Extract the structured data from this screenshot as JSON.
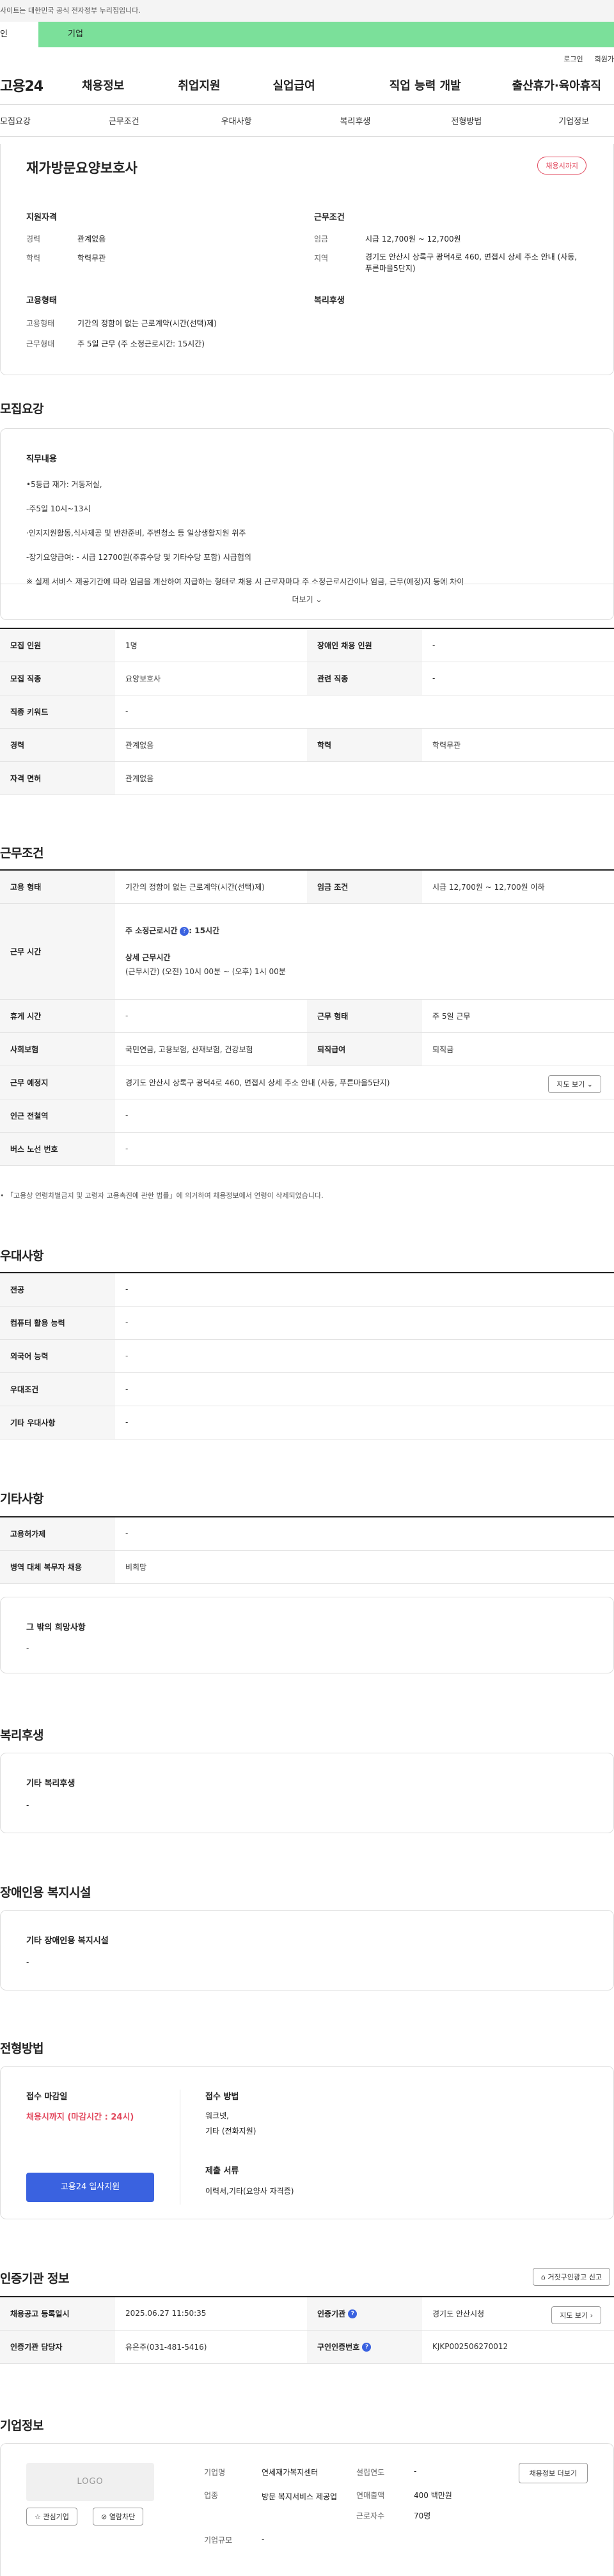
{
  "notice": "사이트는 대한민국 공식 전자정부 누리집입니다.",
  "user_tabs": [
    "인",
    "기업"
  ],
  "top_links": [
    "로그인",
    "회원가"
  ],
  "logo": "고용24",
  "gnb": [
    "채용정보",
    "취업지원",
    "실업급여",
    "직업 능력 개발",
    "출산휴가·육아휴직"
  ],
  "sub_tabs": [
    "모집요강",
    "근무조건",
    "우대사항",
    "복리후생",
    "전형방법",
    "기업정보"
  ],
  "job": {
    "title": "재가방문요양보호사",
    "badge": "채용시까지",
    "qual_h": "지원자격",
    "qual": [
      [
        "경력",
        "관계없음"
      ],
      [
        "학력",
        "학력무관"
      ]
    ],
    "cond_h": "근무조건",
    "cond": [
      [
        "임금",
        "시급 12,700원 ~ 12,700원"
      ],
      [
        "지역",
        "경기도 안산시 상록구 광덕4로 460, 면접시 상세 주소 안내 (사동, 푸른마을5단지)"
      ]
    ],
    "emp_h": "고용형태",
    "emp": [
      [
        "고용형태",
        "기간의 정함이 없는 근로계약(시간(선택)제)"
      ],
      [
        "근무형태",
        "주 5일 근무 (주 소정근로시간: 15시간)"
      ]
    ],
    "welfare_h": "복리후생"
  },
  "recruit": {
    "h": "모집요강",
    "duty_h": "직무내용",
    "lines": [
      "•5등급 재가: 거동저실,",
      "-주5일 10시~13시",
      "·인지지원활동,식사제공 및 반찬준비, 주변청소 등 일상생활지원 위주",
      "-장기요양급여: - 시급 12700원(주휴수당 및 기타수당 포함) 시급협의",
      "※ 실제 서비스 제공기간에 따라 임금을 계산하여 지급하는 형태로 채용 시 근로자마다 주 소정근로시간이나 임금, 근무(예정)지 등에 차이"
    ],
    "more": "더보기",
    "rows": [
      [
        "모집 인원",
        "1명",
        "장애인 채용 인원",
        "-"
      ],
      [
        "모집 직종",
        "요양보호사",
        "관련 직종",
        "-"
      ],
      [
        "직종 키워드",
        "-"
      ],
      [
        "경력",
        "관계없음",
        "학력",
        "학력무관"
      ],
      [
        "자격 면허",
        "관계없음"
      ]
    ]
  },
  "workcond": {
    "h": "근무조건",
    "type_l": "고용 형태",
    "type_v": "기간의 정함이 없는 근로계약(시간(선택)제)",
    "wage_l": "임금 조건",
    "wage_v": "시급 12,700원 ~ 12,700원 이하",
    "time_l": "근무 시간",
    "hours_l": "주 소정근로시간",
    "hours_v": ": 15시간",
    "detail_l": "상세 근무시간",
    "detail_v": "(근무시간) (오전) 10시 00분 ~ (오후) 1시 00분",
    "rest_l": "휴게 시간",
    "rest_v": "-",
    "form_l": "근무 형태",
    "form_v": "주 5일 근무",
    "ins_l": "사회보험",
    "ins_v": "국민연금, 고용보험, 산재보험, 건강보험",
    "ret_l": "퇴직급여",
    "ret_v": "퇴직금",
    "loc_l": "근무 예정지",
    "loc_v": "경기도 안산시 상록구 광덕4로 460, 면접시 상세 주소 안내 (사동, 푸른마을5단지)",
    "map": "지도 보기",
    "sub_l": "인근 전철역",
    "sub_v": "-",
    "bus_l": "버스 노선 번호",
    "bus_v": "-",
    "note": "• 「고용상 연령차별금지 및 고령자 고용촉진에 관한 법률」에 의거하여 채용정보에서 연령이 삭제되었습니다."
  },
  "pref": {
    "h": "우대사항",
    "rows": [
      [
        "전공",
        "-"
      ],
      [
        "컴퓨터 활용 능력",
        "-"
      ],
      [
        "외국어 능력",
        "-"
      ],
      [
        "우대조건",
        "-"
      ],
      [
        "기타 우대사항",
        "-"
      ]
    ]
  },
  "etc": {
    "h": "기타사항",
    "rows": [
      [
        "고용허가제",
        "-"
      ],
      [
        "병역 대체 복무자 채용",
        "비희망"
      ]
    ],
    "box_h": "그 밖의 희망사항",
    "box_v": "-"
  },
  "welfare": {
    "h": "복리후생",
    "box_h": "기타 복리후생",
    "box_v": "-"
  },
  "disab": {
    "h": "장애인용 복지시설",
    "box_h": "기타 장애인용 복지시설",
    "box_v": "-"
  },
  "select": {
    "h": "전형방법",
    "dl_h": "접수 마감일",
    "dl_v": "채용시까지 (마감시간 : 24시)",
    "apply_btn": "고용24 입사지원",
    "m_h": "접수 방법",
    "m_v1": "워크넷,",
    "m_v2": "기타 (전화지원)",
    "doc_h": "제출 서류",
    "doc_v": "이력서,기타(요양사 자격증)"
  },
  "agency": {
    "h": "인증기관 정보",
    "report": "거짓구인광고 신고",
    "rows": [
      [
        "채용공고 등록일시",
        "2025.06.27 11:50:35",
        "인증기관",
        "경기도 안산시청"
      ],
      [
        "인증기관 담당자",
        "유은주(031-481-5416)",
        "구인인증번호",
        "KJKP002506270012"
      ]
    ],
    "map": "지도 보기"
  },
  "company": {
    "h": "기업정보",
    "logo": "LOGO",
    "interest": "관심기업",
    "block": "열람차단",
    "more": "채용정보 더보기",
    "name_l": "기업명",
    "name_v": "연세재가복지센터",
    "est_l": "설립연도",
    "est_v": "-",
    "ind_l": "업종",
    "ind_v": "방문 복지서비스 제공업",
    "sales_l": "연매출액",
    "sales_v": "400 백만원",
    "emp_l": "근로자수",
    "emp_v": "70명",
    "size_l": "기업규모",
    "size_v": "-"
  }
}
